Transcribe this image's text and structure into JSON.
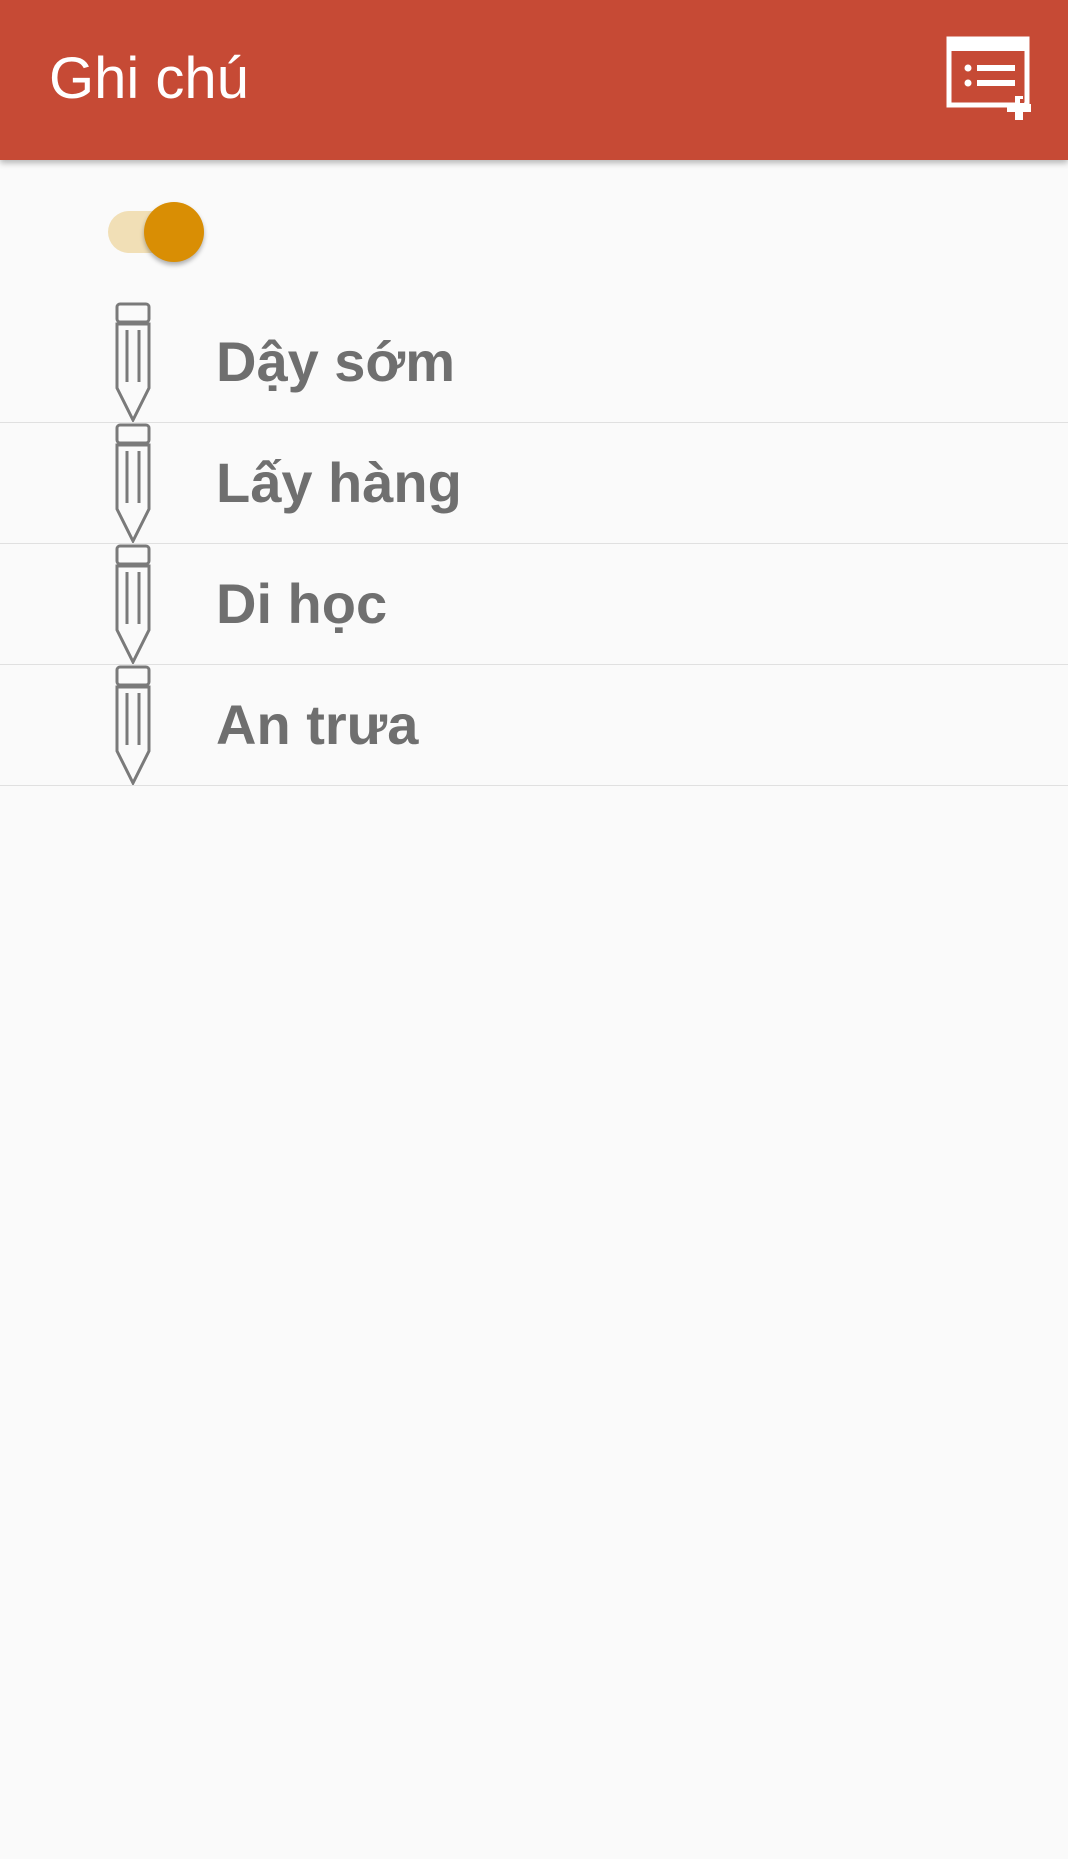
{
  "app_bar": {
    "title": "Ghi chú",
    "background_color": "#c64a35",
    "add_button_icon": "add-note-icon"
  },
  "toggle": {
    "state": "on",
    "accent_color": "#d98e04"
  },
  "notes": [
    {
      "label": "Dậy sớm",
      "icon": "pencil-icon"
    },
    {
      "label": "Lấy hàng",
      "icon": "pencil-icon"
    },
    {
      "label": "Di học",
      "icon": "pencil-icon"
    },
    {
      "label": "An trưa",
      "icon": "pencil-icon"
    }
  ]
}
